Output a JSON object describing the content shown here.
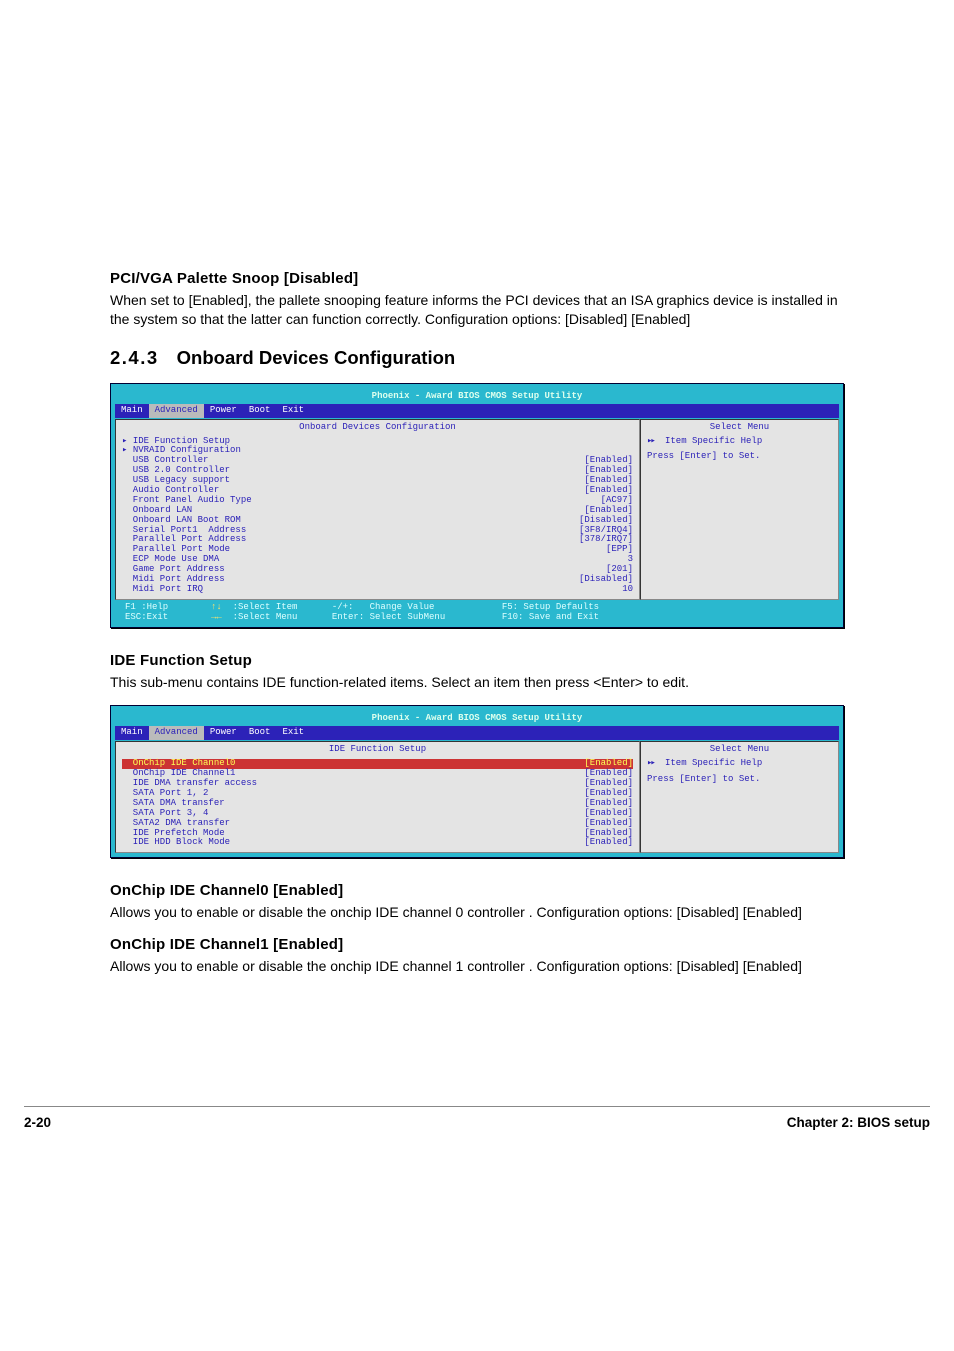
{
  "headings": {
    "pci": "PCI/VGA Palette Snoop [Disabled]",
    "section": {
      "num": "2.4.3",
      "title": "Onboard Devices Configuration"
    },
    "ide_setup": "IDE Function Setup",
    "ch0": "OnChip IDE Channel0 [Enabled]",
    "ch1": "OnChip IDE Channel1 [Enabled]"
  },
  "paragraphs": {
    "pci": "When set to [Enabled], the pallete snooping feature informs the PCI devices that an ISA graphics device is installed in the system so that the latter can function correctly. Configuration options: [Disabled] [Enabled]",
    "ide_setup": "This sub-menu contains IDE function-related items. Select an item then press <Enter> to edit.",
    "ch0": "Allows you to enable or disable the onchip IDE channel 0 controller . Configuration options: [Disabled] [Enabled]",
    "ch1": "Allows you to enable or disable the onchip IDE channel 1 controller . Configuration options: [Disabled] [Enabled]"
  },
  "footer": {
    "page": "2-20",
    "chapter": "Chapter 2: BIOS setup"
  },
  "bios1": {
    "title": "Phoenix - Award BIOS CMOS Setup Utility",
    "tabs": [
      "Main",
      "Advanced",
      "Power",
      "Boot",
      "Exit"
    ],
    "active_tab": 1,
    "panel_header": "Onboard Devices Configuration",
    "help_header": "Select Menu",
    "items": [
      {
        "label": "IDE Function Setup",
        "value": "",
        "tri": true
      },
      {
        "label": "NVRAID Configuration",
        "value": "",
        "tri": true
      },
      {
        "label": "USB Controller",
        "value": "[Enabled]"
      },
      {
        "label": "USB 2.0 Controller",
        "value": "[Enabled]"
      },
      {
        "label": "USB Legacy support",
        "value": "[Enabled]"
      },
      {
        "label": "Audio Controller",
        "value": "[Enabled]"
      },
      {
        "label": "Front Panel Audio Type",
        "value": "[AC97]"
      },
      {
        "label": "Onboard LAN",
        "value": "[Enabled]"
      },
      {
        "label": "Onboard LAN Boot ROM",
        "value": "[Disabled]"
      },
      {
        "label": "Serial Port1  Address",
        "value": "[3F8/IRQ4]"
      },
      {
        "label": "Parallel Port Address",
        "value": "[378/IRQ7]"
      },
      {
        "label": "Parallel Port Mode",
        "value": "[EPP]"
      },
      {
        "label": "ECP Mode Use DMA",
        "value": "3"
      },
      {
        "label": "Game Port Address",
        "value": "[201]"
      },
      {
        "label": "Midi Port Address",
        "value": "[Disabled]"
      },
      {
        "label": "Midi Port IRQ",
        "value": "10"
      }
    ],
    "help": {
      "level": "Item Specific Help",
      "text": "Press [Enter] to Set."
    },
    "footer": {
      "l1": {
        "f1": "F1 :Help",
        "arrows": "  :Select Item",
        "pm": "-/+:   Change Value",
        "f5": "F5: Setup Defaults"
      },
      "l2": {
        "esc": "ESC:Exit",
        "lr": "  :Select Menu",
        "ent": "Enter: Select SubMenu",
        "f10": "F10: Save and Exit"
      }
    }
  },
  "bios2": {
    "title": "Phoenix - Award BIOS CMOS Setup Utility",
    "tabs": [
      "Main",
      "Advanced",
      "Power",
      "Boot",
      "Exit"
    ],
    "active_tab": 1,
    "panel_header": "IDE Function Setup",
    "help_header": "Select Menu",
    "items": [
      {
        "label": "OnChip IDE Channel0",
        "value": "[Enabled]",
        "selected": true
      },
      {
        "label": "OnChip IDE Channel1",
        "value": "[Enabled]"
      },
      {
        "label": "IDE DMA transfer access",
        "value": "[Enabled]"
      },
      {
        "label": "SATA Port 1, 2",
        "value": "[Enabled]"
      },
      {
        "label": "SATA DMA transfer",
        "value": "[Enabled]"
      },
      {
        "label": "SATA Port 3, 4",
        "value": "[Enabled]"
      },
      {
        "label": "SATA2 DMA transfer",
        "value": "[Enabled]"
      },
      {
        "label": "IDE Prefetch Mode",
        "value": "[Enabled]"
      },
      {
        "label": "IDE HDD Block Mode",
        "value": "[Enabled]"
      }
    ],
    "help": {
      "level": "Item Specific Help",
      "text": "Press [Enter] to Set."
    }
  }
}
